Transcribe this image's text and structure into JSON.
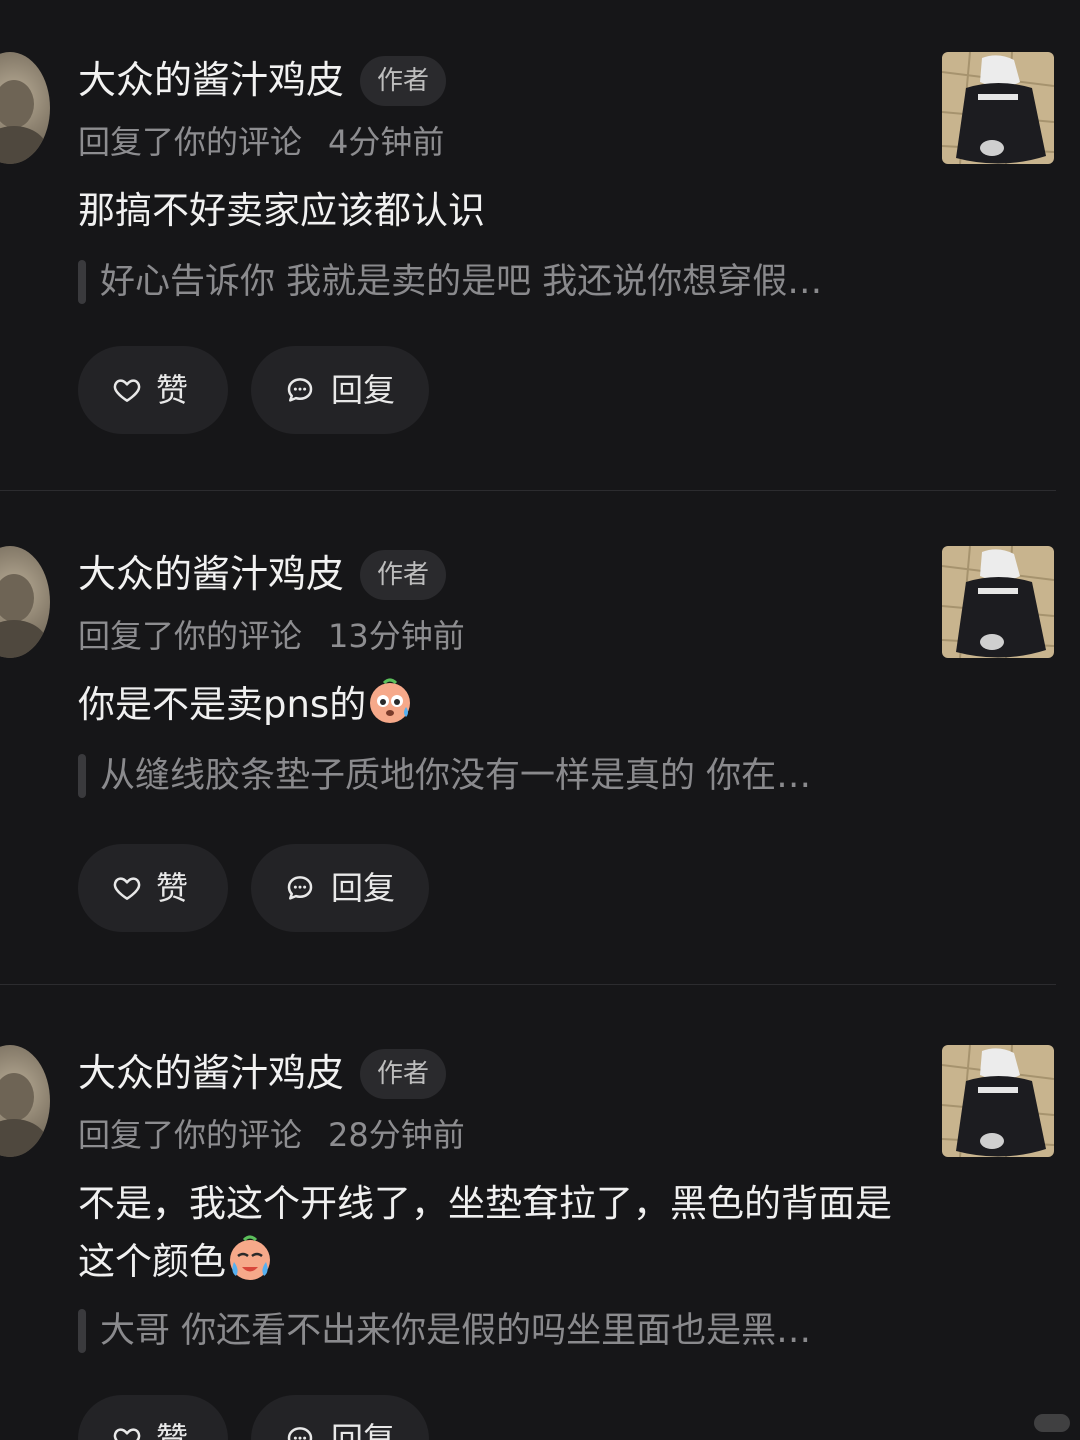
{
  "notifications": [
    {
      "user_name": "大众的酱汁鸡皮",
      "author_tag": "作者",
      "action": "回复了你的评论",
      "time": "4分钟前",
      "reply_text": "那搞不好卖家应该都认识",
      "reply_emoji": "",
      "quote_text": "好心告诉你 我就是卖的是吧 我还说你想穿假…",
      "like_label": "赞",
      "reply_label": "回复"
    },
    {
      "user_name": "大众的酱汁鸡皮",
      "author_tag": "作者",
      "action": "回复了你的评论",
      "time": "13分钟前",
      "reply_text": "你是不是卖pns的",
      "reply_emoji": "sweat-face-emoji",
      "quote_text": "从缝线胶条垫子质地你没有一样是真的 你在…",
      "like_label": "赞",
      "reply_label": "回复"
    },
    {
      "user_name": "大众的酱汁鸡皮",
      "author_tag": "作者",
      "action": "回复了你的评论",
      "time": "28分钟前",
      "reply_text": "不是，我这个开线了，坐垫耷拉了，黑色的背面是这个颜色",
      "reply_emoji": "crying-face-emoji",
      "quote_text": "大哥 你还看不出来你是假的吗坐里面也是黑…",
      "like_label": "赞",
      "reply_label": "回复"
    }
  ],
  "icons": {
    "like": "heart-icon",
    "reply": "comment-bubble-icon"
  },
  "colors": {
    "background": "#161618",
    "button_bg": "#232326",
    "secondary_text": "#8d8d90",
    "quote_bar": "#3a3a3d"
  }
}
